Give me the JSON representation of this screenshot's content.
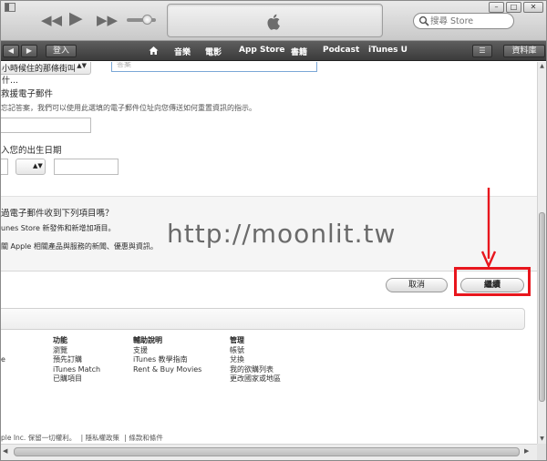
{
  "toolbar": {
    "search_placeholder": "搜尋 Store",
    "prev_symbol": "◀◀",
    "play_symbol": "▶",
    "next_symbol": "▶▶"
  },
  "navbar": {
    "login_label": "登入",
    "links": [
      "音樂",
      "電影",
      "App Store",
      "書籍",
      "Podcast",
      "iTunes U"
    ],
    "library_label": "資料庫"
  },
  "form": {
    "question_select_value": "小時候住的那條街叫什…",
    "answer_placeholder": "答案",
    "rescue_email_title": "救援電子郵件",
    "rescue_email_desc": "忘記答案，我們可以使用此選填的電子郵件位址向您傳送如何重置資訊的指示。",
    "birthday_title": "入您的出生日期"
  },
  "subscribe": {
    "question": "過電子郵件收到下列項目嗎？",
    "item1": "unes Store 新發佈和新增加項目。",
    "item2": "關 Apple 相關產品與服務的新聞、優惠與資訊。"
  },
  "buttons": {
    "cancel": "取消",
    "continue": "繼續"
  },
  "watermark": "http://moonlit.tw",
  "footer": {
    "col0": [
      "e"
    ],
    "col1_title": "功能",
    "col1": [
      "瀏覽",
      "預先訂購",
      "iTunes Match",
      "已購項目"
    ],
    "col2_title": "輔助說明",
    "col2": [
      "支援",
      "iTunes 教學指南",
      "Rent & Buy Movies"
    ],
    "col3_title": "管理",
    "col3": [
      "帳號",
      "兌換",
      "我的欲購列表",
      "更改國家或地區"
    ],
    "copyright": "ple Inc. 保留一切權利。",
    "privacy": "隱私權政策",
    "terms": "條款和條件",
    "separator": "|"
  },
  "colors": {
    "highlight_red": "#e8161d",
    "nav_bg": "#4a4a4a"
  }
}
